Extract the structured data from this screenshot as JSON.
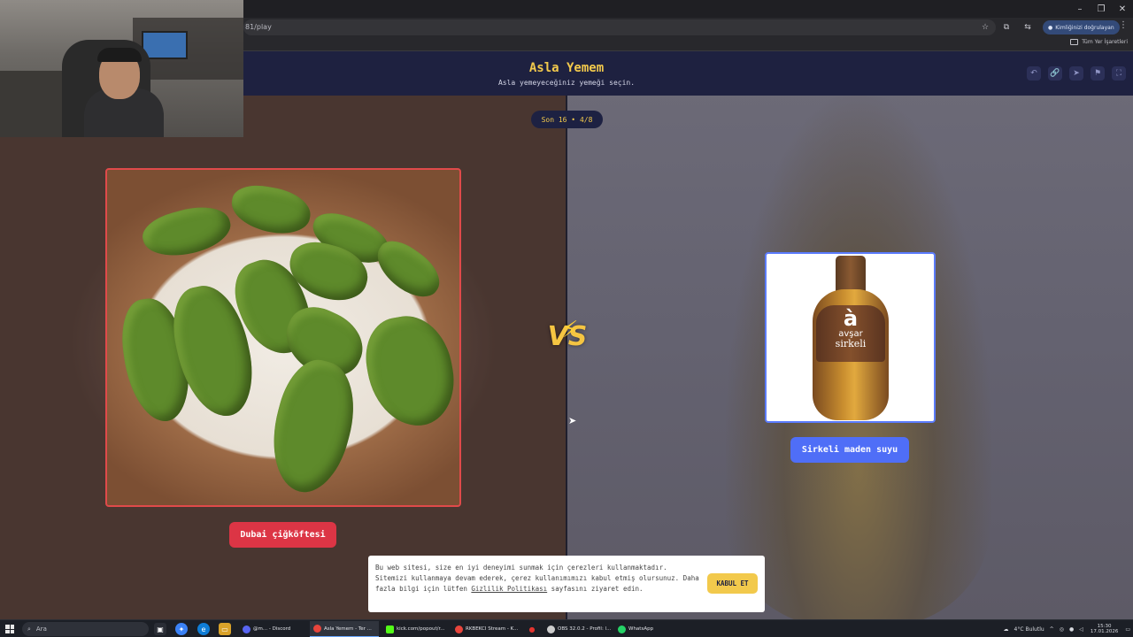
{
  "browser": {
    "url": "81/play",
    "identity_label": "Kimliğinizi doğrulayan",
    "bookmarks_all_label": "Tüm Yer İşaretleri",
    "window_controls": [
      "–",
      "❐",
      "✕"
    ],
    "bar_icons": [
      "☆",
      "⧉",
      "⇆"
    ],
    "menu_icon": "⋮"
  },
  "game": {
    "title": "Asla Yemem",
    "subtitle": "Asla yemeyeceğiniz yemeği seçin.",
    "round_badge": "Son 16 • 4/8",
    "header_actions": [
      "↶",
      "🔗",
      "➤",
      "⚑",
      "⛶"
    ],
    "vs_text": "VS",
    "bolt_icon": "⚡",
    "left_choice": {
      "label": "Dubai çiğköftesi"
    },
    "right_choice": {
      "label": "Sirkeli maden suyu",
      "bottle_mark": "à",
      "bottle_brand": "avşar",
      "bottle_variant": "sirkeli"
    },
    "accent_colors": {
      "title": "#f2c94c",
      "left": "#dc3545",
      "right": "#4f6ef7",
      "header": "#1e2140"
    }
  },
  "cookie_banner": {
    "text_before_link": "Bu web sitesi, size en iyi deneyimi sunmak için çerezleri kullanmaktadır. Sitemizi kullanmaya devam ederek, çerez kullanımımızı kabul etmiş olursunuz. Daha fazla bilgi için lütfen ",
    "link_text": "Gizlilik Politikası",
    "text_after_link": " sayfasını ziyaret edin.",
    "accept_label": "KABUL ET"
  },
  "taskbar": {
    "search_placeholder": "Ara",
    "apps": [
      {
        "label": "@m... - Discord",
        "color": "#5865f2"
      },
      {
        "label": "Asla Yemem - Ter ...",
        "color": "#e8453c"
      },
      {
        "label": "kick.com/popout/r...",
        "color": "#53fc18"
      },
      {
        "label": "RKBEKCI Stream - K...",
        "color": "#e8453c"
      },
      {
        "label": "OBS 32.0.2 - Profil: l...",
        "color": "#cccccc"
      },
      {
        "label": "WhatsApp",
        "color": "#25d366"
      }
    ],
    "weather": "4°C  Bulutlu",
    "time": "15:30",
    "date": "17.01.2026"
  }
}
